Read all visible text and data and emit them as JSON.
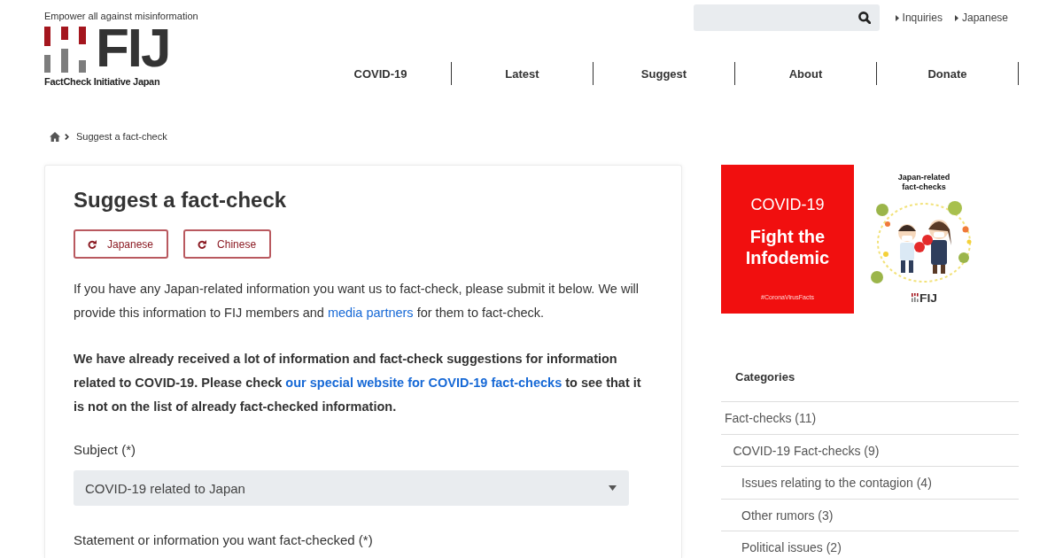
{
  "header": {
    "tagline": "Empower all against misinformation",
    "logo": {
      "mark": "FIJ",
      "name": "FactCheck Initiative Japan"
    },
    "top_links": [
      {
        "label": "Inquiries"
      },
      {
        "label": "Japanese"
      }
    ],
    "nav": [
      {
        "label": "COVID-19"
      },
      {
        "label": "Latest"
      },
      {
        "label": "Suggest"
      },
      {
        "label": "About"
      },
      {
        "label": "Donate"
      }
    ]
  },
  "breadcrumb": {
    "current": "Suggest a fact-check"
  },
  "form": {
    "title": "Suggest a fact-check",
    "language_buttons": [
      {
        "label": "Japanese"
      },
      {
        "label": "Chinese"
      }
    ],
    "paragraphs": [
      {
        "kind": "plain",
        "parts": [
          {
            "kind": "text",
            "text": "If you have any Japan-related information you want us to fact-check, please submit it below. We will provide this information to FIJ members and "
          },
          {
            "kind": "link",
            "text": "media partners"
          },
          {
            "kind": "text",
            "text": " for them to fact-check."
          }
        ]
      },
      {
        "kind": "notice",
        "parts": [
          {
            "kind": "text",
            "text": "We have already received a lot of information and fact-check suggestions for information related to COVID-19. Please check "
          },
          {
            "kind": "link",
            "text": "our special website for COVID-19 fact-checks"
          },
          {
            "kind": "text",
            "text": " to see that it is not on the list of already fact-checked information."
          }
        ]
      }
    ],
    "fields": [
      {
        "kind": "select",
        "label": "Subject (*)",
        "value": "COVID-19 related to Japan"
      },
      {
        "kind": "textarea",
        "label": "Statement or information you want fact-checked (*)"
      }
    ]
  },
  "sidebar": {
    "banners": [
      {
        "kind": "infodemic",
        "heading": "COVID-19",
        "title": "Fight the Infodemic",
        "hashtag": "#CoronaVirusFacts"
      },
      {
        "kind": "illustration",
        "title": "Japan-related fact-checks",
        "mark": "FIJ"
      }
    ],
    "categories": {
      "title": "Categories",
      "items": [
        {
          "label": "Fact-checks (11)",
          "children": [
            {
              "label": "COVID-19 Fact-checks (9)",
              "children": [
                {
                  "label": "Issues relating to the contagion (4)"
                },
                {
                  "label": "Other rumors (3)"
                },
                {
                  "label": "Political issues (2)"
                }
              ]
            }
          ]
        }
      ]
    }
  }
}
